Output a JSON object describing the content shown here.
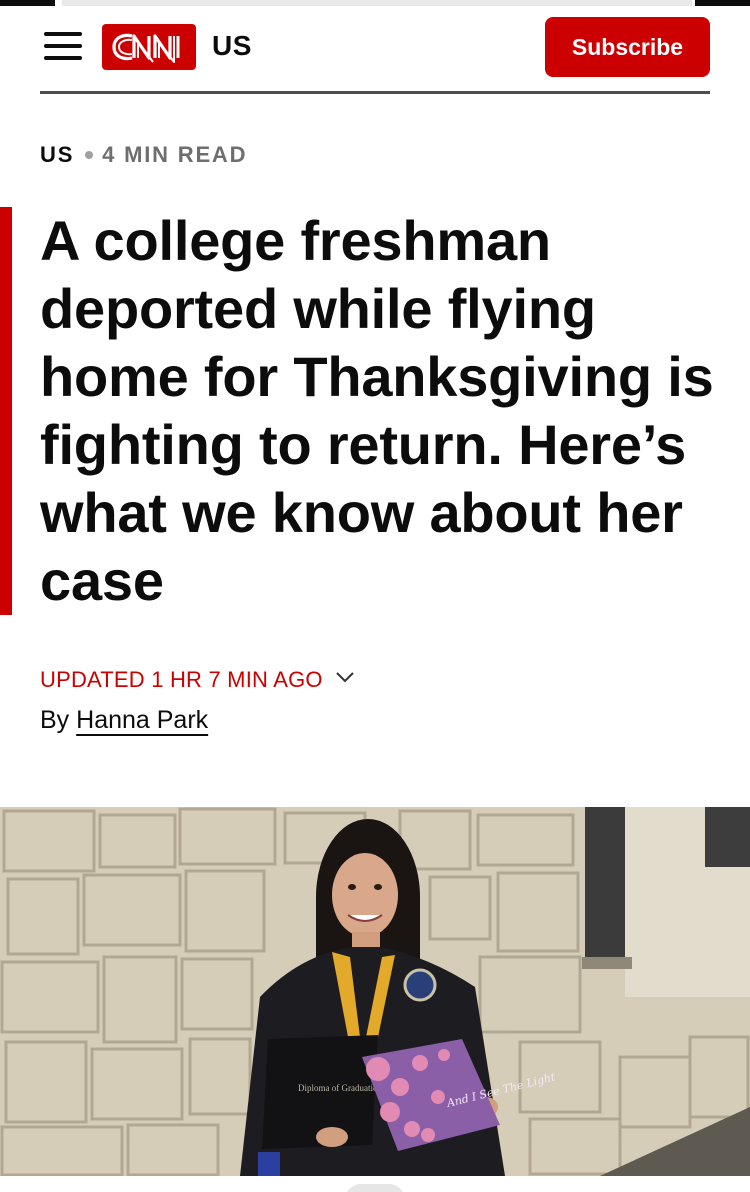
{
  "header": {
    "logo_text": "CNN",
    "edition": "US",
    "subscribe_label": "Subscribe",
    "menu_icon": "hamburger-menu-icon"
  },
  "article": {
    "section": "US",
    "read_time": "4 MIN READ",
    "headline": "A college freshman deported while flying home for Thanksgiving is fighting to return. Here’s what we know about her case",
    "updated": "UPDATED 1 HR 7 MIN AGO",
    "byline_prefix": "By",
    "author": "Hanna Park"
  },
  "hero_image": {
    "diploma_text": "Diploma of Graduation",
    "cap_text": "And I See The Light"
  },
  "colors": {
    "brand_red": "#cc0000",
    "text": "#0c0c0c",
    "rule": "#4d4d4d"
  }
}
